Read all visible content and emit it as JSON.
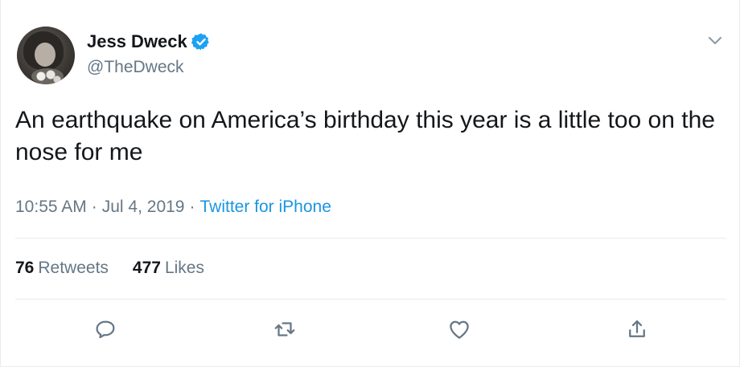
{
  "author": {
    "display_name": "Jess Dweck",
    "handle": "@TheDweck",
    "verified": true
  },
  "tweet": {
    "text": "An earthquake on America’s birthday this year is a little too on the nose for me",
    "time": "10:55 AM",
    "date": "Jul 4, 2019",
    "separator": "·",
    "source": "Twitter for iPhone"
  },
  "stats": {
    "retweets_count": "76",
    "retweets_label": "Retweets",
    "likes_count": "477",
    "likes_label": "Likes"
  },
  "actions": [
    {
      "icon": "reply-icon"
    },
    {
      "icon": "retweet-icon"
    },
    {
      "icon": "like-icon"
    },
    {
      "icon": "share-icon"
    }
  ],
  "colors": {
    "text": "#14171a",
    "secondary": "#657786",
    "link": "#1b95e0",
    "verified_badge": "#1da1f2",
    "divider": "#e6ecf0"
  }
}
